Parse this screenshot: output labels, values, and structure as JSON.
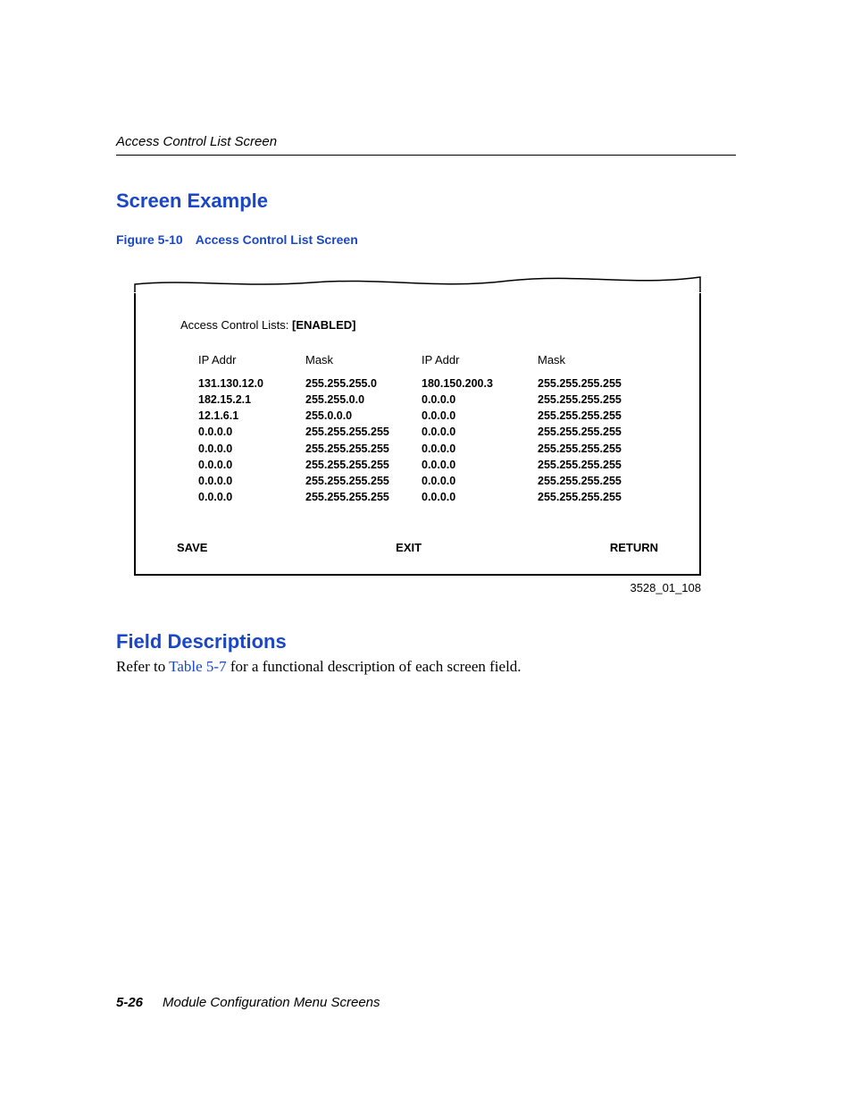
{
  "running_head": "Access Control List Screen",
  "heading_screen_example": "Screen Example",
  "figure": {
    "number": "Figure 5-10",
    "title": "Access Control List Screen",
    "image_id": "3528_01_108"
  },
  "screen": {
    "status_label": "Access Control Lists: ",
    "status_value": "[ENABLED]",
    "columns": {
      "left_ip_header": "IP Addr",
      "left_mask_header": "Mask",
      "right_ip_header": "IP Addr",
      "right_mask_header": "Mask"
    },
    "rows_left": [
      {
        "ip": "131.130.12.0",
        "mask": "255.255.255.0"
      },
      {
        "ip": "182.15.2.1",
        "mask": "255.255.0.0"
      },
      {
        "ip": "12.1.6.1",
        "mask": "255.0.0.0"
      },
      {
        "ip": "0.0.0.0",
        "mask": "255.255.255.255"
      },
      {
        "ip": "0.0.0.0",
        "mask": "255.255.255.255"
      },
      {
        "ip": "0.0.0.0",
        "mask": "255.255.255.255"
      },
      {
        "ip": "0.0.0.0",
        "mask": "255.255.255.255"
      },
      {
        "ip": "0.0.0.0",
        "mask": "255.255.255.255"
      }
    ],
    "rows_right": [
      {
        "ip": "180.150.200.3",
        "mask": "255.255.255.255"
      },
      {
        "ip": "0.0.0.0",
        "mask": "255.255.255.255"
      },
      {
        "ip": "0.0.0.0",
        "mask": "255.255.255.255"
      },
      {
        "ip": "0.0.0.0",
        "mask": "255.255.255.255"
      },
      {
        "ip": "0.0.0.0",
        "mask": "255.255.255.255"
      },
      {
        "ip": "0.0.0.0",
        "mask": "255.255.255.255"
      },
      {
        "ip": "0.0.0.0",
        "mask": "255.255.255.255"
      },
      {
        "ip": "0.0.0.0",
        "mask": "255.255.255.255"
      }
    ],
    "buttons": {
      "save": "SAVE",
      "exit": "EXIT",
      "return": "RETURN"
    }
  },
  "heading_field_desc": "Field Descriptions",
  "field_desc_text": {
    "pre": "Refer to ",
    "link": "Table 5-7",
    "post": " for a functional description of each screen field."
  },
  "footer": {
    "page": "5-26",
    "title": "Module Configuration Menu Screens"
  }
}
